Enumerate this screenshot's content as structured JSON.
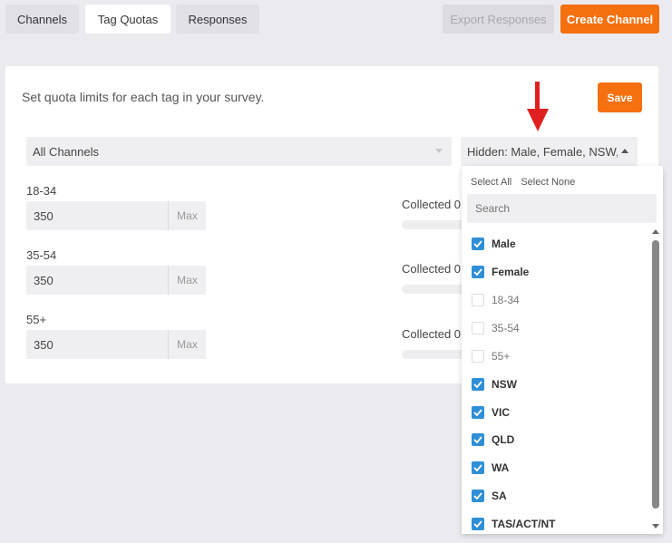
{
  "tabs": {
    "channels": "Channels",
    "tag_quotas": "Tag Quotas",
    "responses": "Responses"
  },
  "toolbar": {
    "export_label": "Export Responses",
    "create_label": "Create Channel"
  },
  "main": {
    "intro": "Set quota limits for each tag in your survey.",
    "save_label": "Save",
    "channel_filter": "All Channels",
    "hidden_filter": "Hidden: Male, Female, NSW, VIC, QLD, WA, SA, TAS/ACT/NT"
  },
  "quotas": [
    {
      "label": "18-34",
      "value": "350",
      "unit": "Max",
      "collected": "Collected 0"
    },
    {
      "label": "35-54",
      "value": "350",
      "unit": "Max",
      "collected": "Collected 0"
    },
    {
      "label": "55+",
      "value": "350",
      "unit": "Max",
      "collected": "Collected 0"
    }
  ],
  "dropdown": {
    "select_all": "Select All",
    "select_none": "Select None",
    "search_placeholder": "Search",
    "options": [
      {
        "label": "Male",
        "checked": true
      },
      {
        "label": "Female",
        "checked": true
      },
      {
        "label": "18-34",
        "checked": false
      },
      {
        "label": "35-54",
        "checked": false
      },
      {
        "label": "55+",
        "checked": false
      },
      {
        "label": "NSW",
        "checked": true
      },
      {
        "label": "VIC",
        "checked": true
      },
      {
        "label": "QLD",
        "checked": true
      },
      {
        "label": "WA",
        "checked": true
      },
      {
        "label": "SA",
        "checked": true
      },
      {
        "label": "TAS/ACT/NT",
        "checked": true
      }
    ]
  },
  "colors": {
    "accent": "#f5700f",
    "checkbox": "#2f8fd6",
    "annotation_arrow": "#e02020"
  },
  "icons": {
    "annotation": "down-arrow-icon",
    "checkbox": "checkmark-icon"
  }
}
